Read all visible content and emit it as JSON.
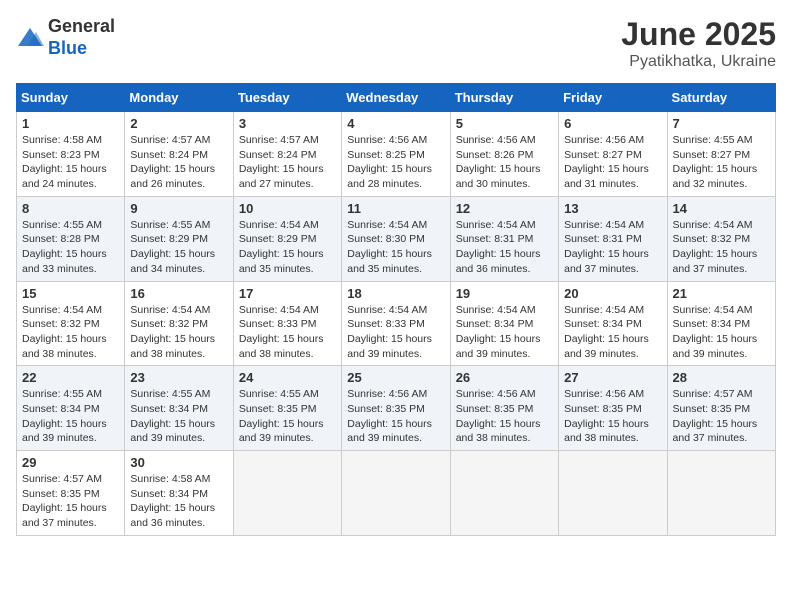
{
  "header": {
    "logo_general": "General",
    "logo_blue": "Blue",
    "title": "June 2025",
    "subtitle": "Pyatikhatka, Ukraine"
  },
  "calendar": {
    "days_of_week": [
      "Sunday",
      "Monday",
      "Tuesday",
      "Wednesday",
      "Thursday",
      "Friday",
      "Saturday"
    ],
    "weeks": [
      [
        {
          "day": "1",
          "sunrise": "4:58 AM",
          "sunset": "8:23 PM",
          "daylight": "15 hours and 24 minutes."
        },
        {
          "day": "2",
          "sunrise": "4:57 AM",
          "sunset": "8:24 PM",
          "daylight": "15 hours and 26 minutes."
        },
        {
          "day": "3",
          "sunrise": "4:57 AM",
          "sunset": "8:24 PM",
          "daylight": "15 hours and 27 minutes."
        },
        {
          "day": "4",
          "sunrise": "4:56 AM",
          "sunset": "8:25 PM",
          "daylight": "15 hours and 28 minutes."
        },
        {
          "day": "5",
          "sunrise": "4:56 AM",
          "sunset": "8:26 PM",
          "daylight": "15 hours and 30 minutes."
        },
        {
          "day": "6",
          "sunrise": "4:56 AM",
          "sunset": "8:27 PM",
          "daylight": "15 hours and 31 minutes."
        },
        {
          "day": "7",
          "sunrise": "4:55 AM",
          "sunset": "8:27 PM",
          "daylight": "15 hours and 32 minutes."
        }
      ],
      [
        {
          "day": "8",
          "sunrise": "4:55 AM",
          "sunset": "8:28 PM",
          "daylight": "15 hours and 33 minutes."
        },
        {
          "day": "9",
          "sunrise": "4:55 AM",
          "sunset": "8:29 PM",
          "daylight": "15 hours and 34 minutes."
        },
        {
          "day": "10",
          "sunrise": "4:54 AM",
          "sunset": "8:29 PM",
          "daylight": "15 hours and 35 minutes."
        },
        {
          "day": "11",
          "sunrise": "4:54 AM",
          "sunset": "8:30 PM",
          "daylight": "15 hours and 35 minutes."
        },
        {
          "day": "12",
          "sunrise": "4:54 AM",
          "sunset": "8:31 PM",
          "daylight": "15 hours and 36 minutes."
        },
        {
          "day": "13",
          "sunrise": "4:54 AM",
          "sunset": "8:31 PM",
          "daylight": "15 hours and 37 minutes."
        },
        {
          "day": "14",
          "sunrise": "4:54 AM",
          "sunset": "8:32 PM",
          "daylight": "15 hours and 37 minutes."
        }
      ],
      [
        {
          "day": "15",
          "sunrise": "4:54 AM",
          "sunset": "8:32 PM",
          "daylight": "15 hours and 38 minutes."
        },
        {
          "day": "16",
          "sunrise": "4:54 AM",
          "sunset": "8:32 PM",
          "daylight": "15 hours and 38 minutes."
        },
        {
          "day": "17",
          "sunrise": "4:54 AM",
          "sunset": "8:33 PM",
          "daylight": "15 hours and 38 minutes."
        },
        {
          "day": "18",
          "sunrise": "4:54 AM",
          "sunset": "8:33 PM",
          "daylight": "15 hours and 39 minutes."
        },
        {
          "day": "19",
          "sunrise": "4:54 AM",
          "sunset": "8:34 PM",
          "daylight": "15 hours and 39 minutes."
        },
        {
          "day": "20",
          "sunrise": "4:54 AM",
          "sunset": "8:34 PM",
          "daylight": "15 hours and 39 minutes."
        },
        {
          "day": "21",
          "sunrise": "4:54 AM",
          "sunset": "8:34 PM",
          "daylight": "15 hours and 39 minutes."
        }
      ],
      [
        {
          "day": "22",
          "sunrise": "4:55 AM",
          "sunset": "8:34 PM",
          "daylight": "15 hours and 39 minutes."
        },
        {
          "day": "23",
          "sunrise": "4:55 AM",
          "sunset": "8:34 PM",
          "daylight": "15 hours and 39 minutes."
        },
        {
          "day": "24",
          "sunrise": "4:55 AM",
          "sunset": "8:35 PM",
          "daylight": "15 hours and 39 minutes."
        },
        {
          "day": "25",
          "sunrise": "4:56 AM",
          "sunset": "8:35 PM",
          "daylight": "15 hours and 39 minutes."
        },
        {
          "day": "26",
          "sunrise": "4:56 AM",
          "sunset": "8:35 PM",
          "daylight": "15 hours and 38 minutes."
        },
        {
          "day": "27",
          "sunrise": "4:56 AM",
          "sunset": "8:35 PM",
          "daylight": "15 hours and 38 minutes."
        },
        {
          "day": "28",
          "sunrise": "4:57 AM",
          "sunset": "8:35 PM",
          "daylight": "15 hours and 37 minutes."
        }
      ],
      [
        {
          "day": "29",
          "sunrise": "4:57 AM",
          "sunset": "8:35 PM",
          "daylight": "15 hours and 37 minutes."
        },
        {
          "day": "30",
          "sunrise": "4:58 AM",
          "sunset": "8:34 PM",
          "daylight": "15 hours and 36 minutes."
        },
        null,
        null,
        null,
        null,
        null
      ]
    ]
  }
}
